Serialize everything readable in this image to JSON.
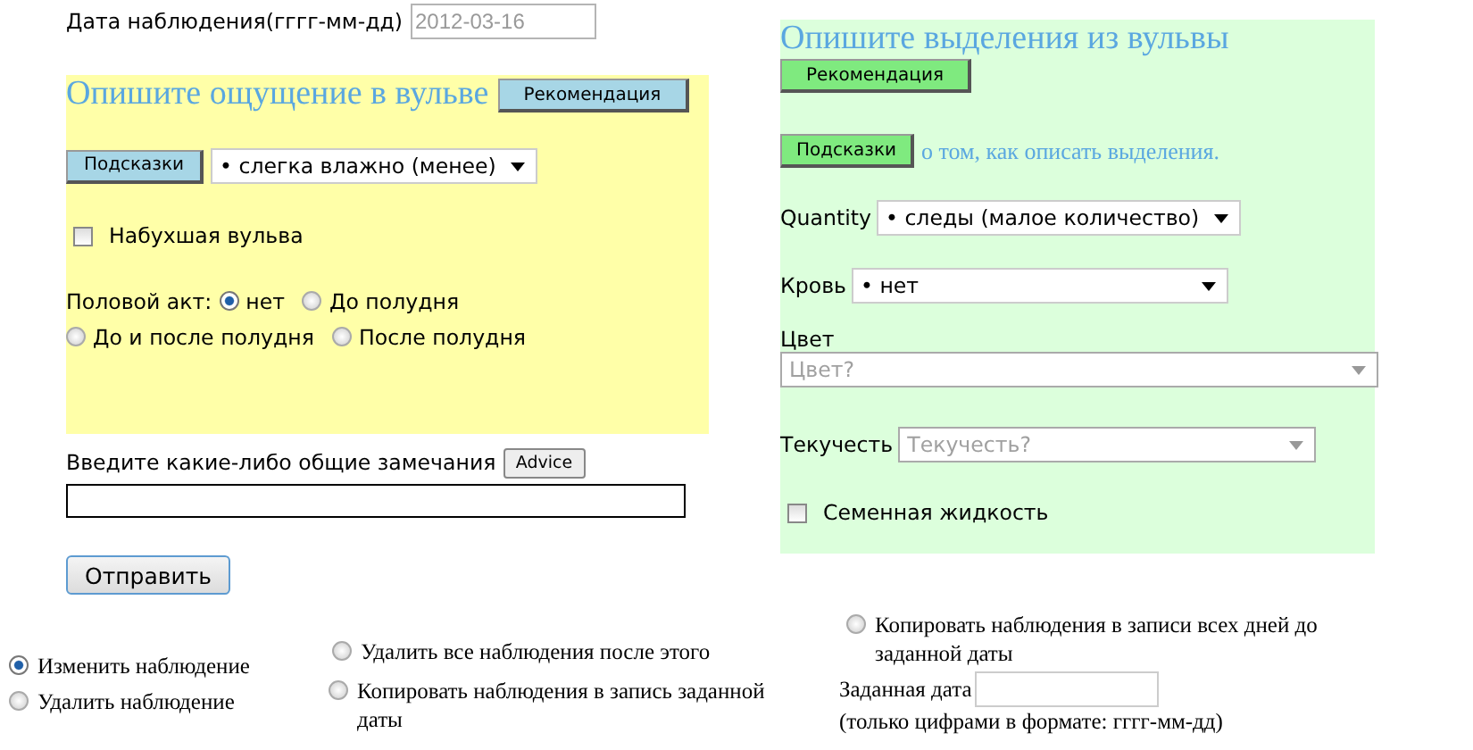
{
  "date_field": {
    "label": "Дата наблюдения(гггг-мм-дд)",
    "value": "2012-03-16",
    "disabled": true
  },
  "sensation_panel": {
    "title": "Опишите ощущение в вульве",
    "recommendation_button": "Рекомендация",
    "hints_button": "Подсказки",
    "select": {
      "value": "• слегка влажно (менее)"
    },
    "checkbox": {
      "label": "Набухшая вульва",
      "checked": false
    },
    "intercourse": {
      "label": "Половой акт:",
      "options": [
        {
          "label": "нет",
          "selected": true
        },
        {
          "label": "До полудня",
          "selected": false
        },
        {
          "label": "До и после полудня",
          "selected": false
        },
        {
          "label": "После полудня",
          "selected": false
        }
      ]
    }
  },
  "remarks": {
    "label": "Введите какие-либо общие замечания",
    "advice_button": "Advice"
  },
  "submit_button": "Отправить",
  "discharge_panel": {
    "title": "Опишите выделения из вульвы",
    "recommendation_button": "Рекомендация",
    "hints_button": "Подсказки",
    "hints_text": "о том, как описать выделения.",
    "fields": [
      {
        "kind": "inline",
        "label": "Quantity",
        "value": "• следы (малое количество)"
      },
      {
        "kind": "inline",
        "label": "Кровь",
        "value": "• нет"
      },
      {
        "kind": "stacked",
        "label": "Цвет",
        "placeholder": "Цвет?"
      },
      {
        "kind": "inline",
        "label": "Текучесть",
        "placeholder": "Текучесть?"
      }
    ],
    "checkbox": {
      "label": "Семенная жидкость",
      "checked": false
    }
  },
  "action_columns": [
    {
      "options": [
        {
          "label": "Изменить наблюдение",
          "selected": true
        },
        {
          "label": "Удалить наблюдение",
          "selected": false
        }
      ]
    },
    {
      "options": [
        {
          "label": "Удалить все наблюдения после этого",
          "selected": false
        },
        {
          "label": "Копировать наблюдения в запись заданной даты",
          "selected": false
        }
      ]
    },
    {
      "options": [
        {
          "label": "Копировать наблюдения в записи всех дней до заданной даты",
          "selected": false
        }
      ]
    }
  ],
  "target_date": {
    "label": "Заданная дата",
    "note": "(только цифрами в формате: гггг-мм-дд)"
  }
}
